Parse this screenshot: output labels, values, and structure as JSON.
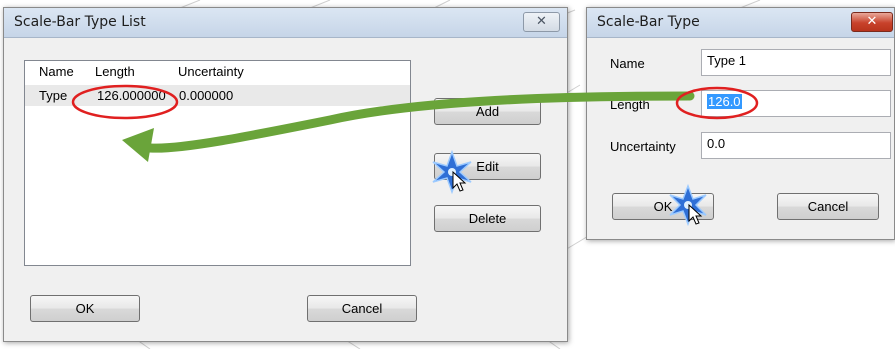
{
  "list_dialog": {
    "title": "Scale-Bar Type List",
    "close_glyph": "✕",
    "columns": [
      "Name",
      "Length",
      "Uncertainty"
    ],
    "rows": [
      {
        "name": "Type",
        "length": "126.000000",
        "uncertainty": "0.000000"
      }
    ],
    "add_label": "Add",
    "edit_label": "Edit",
    "delete_label": "Delete",
    "ok_label": "OK",
    "cancel_label": "Cancel"
  },
  "type_dialog": {
    "title": "Scale-Bar Type",
    "close_glyph": "✕",
    "name_label": "Name",
    "name_value": "Type 1",
    "length_label": "Length",
    "length_value": "126.0",
    "uncertainty_label": "Uncertainty",
    "uncertainty_value": "0.0",
    "ok_label": "OK",
    "cancel_label": "Cancel"
  },
  "annotations": {
    "arrow_color": "#6aa43a",
    "highlight_color": "#e02020",
    "click_burst_color": "#2f6fd6",
    "icons": [
      "click-burst-icon",
      "mouse-cursor-icon"
    ]
  }
}
